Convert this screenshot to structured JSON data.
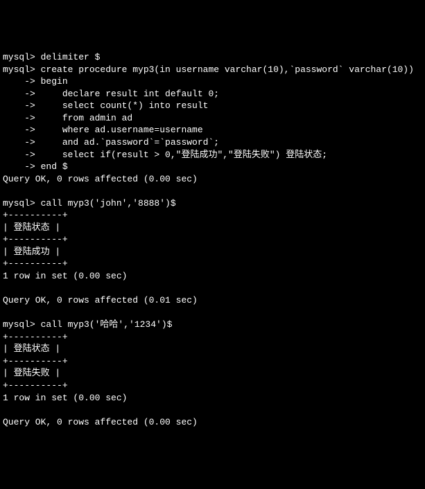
{
  "lines": {
    "l01": "mysql> delimiter $",
    "l02": "mysql> create procedure myp3(in username varchar(10),`password` varchar(10))",
    "l03": "    -> begin",
    "l04": "    ->     declare result int default 0;",
    "l05": "    ->     select count(*) into result",
    "l06": "    ->     from admin ad",
    "l07": "    ->     where ad.username=username",
    "l08": "    ->     and ad.`password`=`password`;",
    "l09": "    ->     select if(result > 0,\"登陆成功\",\"登陆失败\") 登陆状态;",
    "l10": "    -> end $",
    "l11": "Query OK, 0 rows affected (0.00 sec)",
    "l12": "",
    "l13": "mysql> call myp3('john','8888')$",
    "l14": "+----------+",
    "l15": "| 登陆状态 |",
    "l16": "+----------+",
    "l17": "| 登陆成功 |",
    "l18": "+----------+",
    "l19": "1 row in set (0.00 sec)",
    "l20": "",
    "l21": "Query OK, 0 rows affected (0.01 sec)",
    "l22": "",
    "l23": "mysql> call myp3('哈哈','1234')$",
    "l24": "+----------+",
    "l25": "| 登陆状态 |",
    "l26": "+----------+",
    "l27": "| 登陆失败 |",
    "l28": "+----------+",
    "l29": "1 row in set (0.00 sec)",
    "l30": "",
    "l31": "Query OK, 0 rows affected (0.00 sec)"
  }
}
